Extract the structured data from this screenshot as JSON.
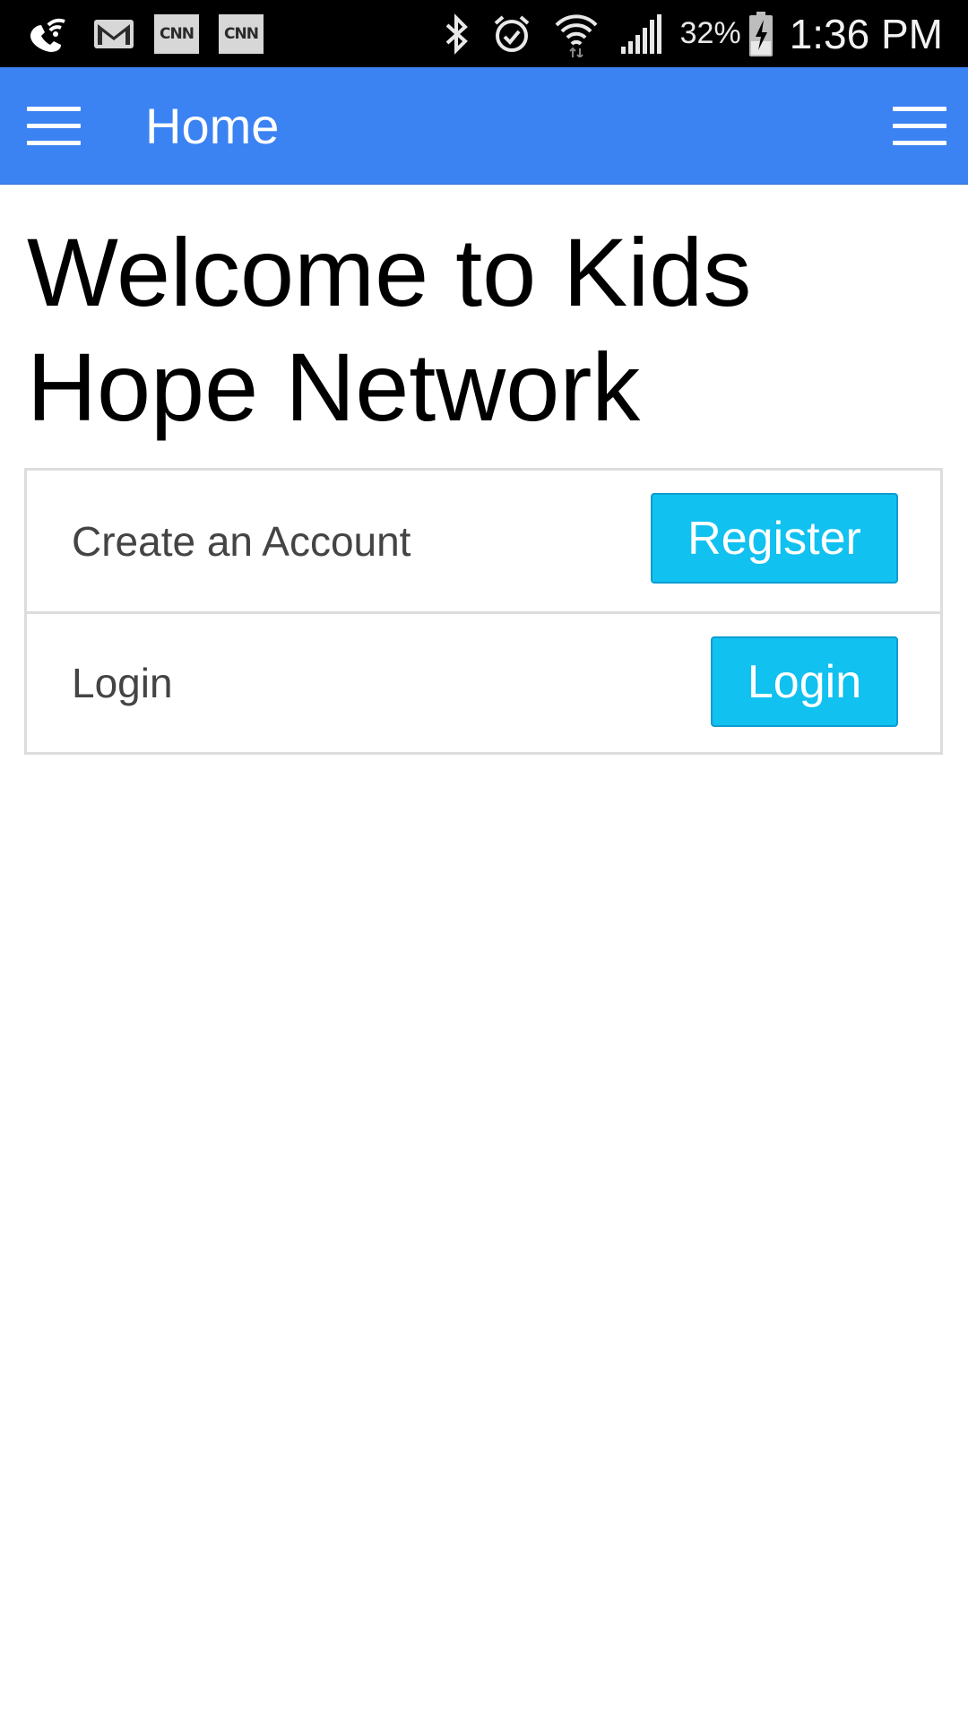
{
  "status_bar": {
    "left_icons": [
      "wifi-calling-icon",
      "gmail-icon",
      "cnn-icon",
      "cnn-icon"
    ],
    "cnn_label": "CNN",
    "right_icons": [
      "bluetooth-icon",
      "alarm-icon",
      "wifi-icon",
      "signal-icon",
      "battery-charging-icon"
    ],
    "battery_percent": "32%",
    "time": "1:36 PM"
  },
  "app_bar": {
    "title": "Home",
    "color": "#3b82f2",
    "left_icon": "hamburger-menu-icon",
    "right_icon": "hamburger-menu-icon"
  },
  "main": {
    "heading": "Welcome to Kids Hope Network",
    "rows": [
      {
        "label": "Create an Account",
        "button_label": "Register"
      },
      {
        "label": "Login",
        "button_label": "Login"
      }
    ],
    "button_color": "#11c1f0"
  }
}
